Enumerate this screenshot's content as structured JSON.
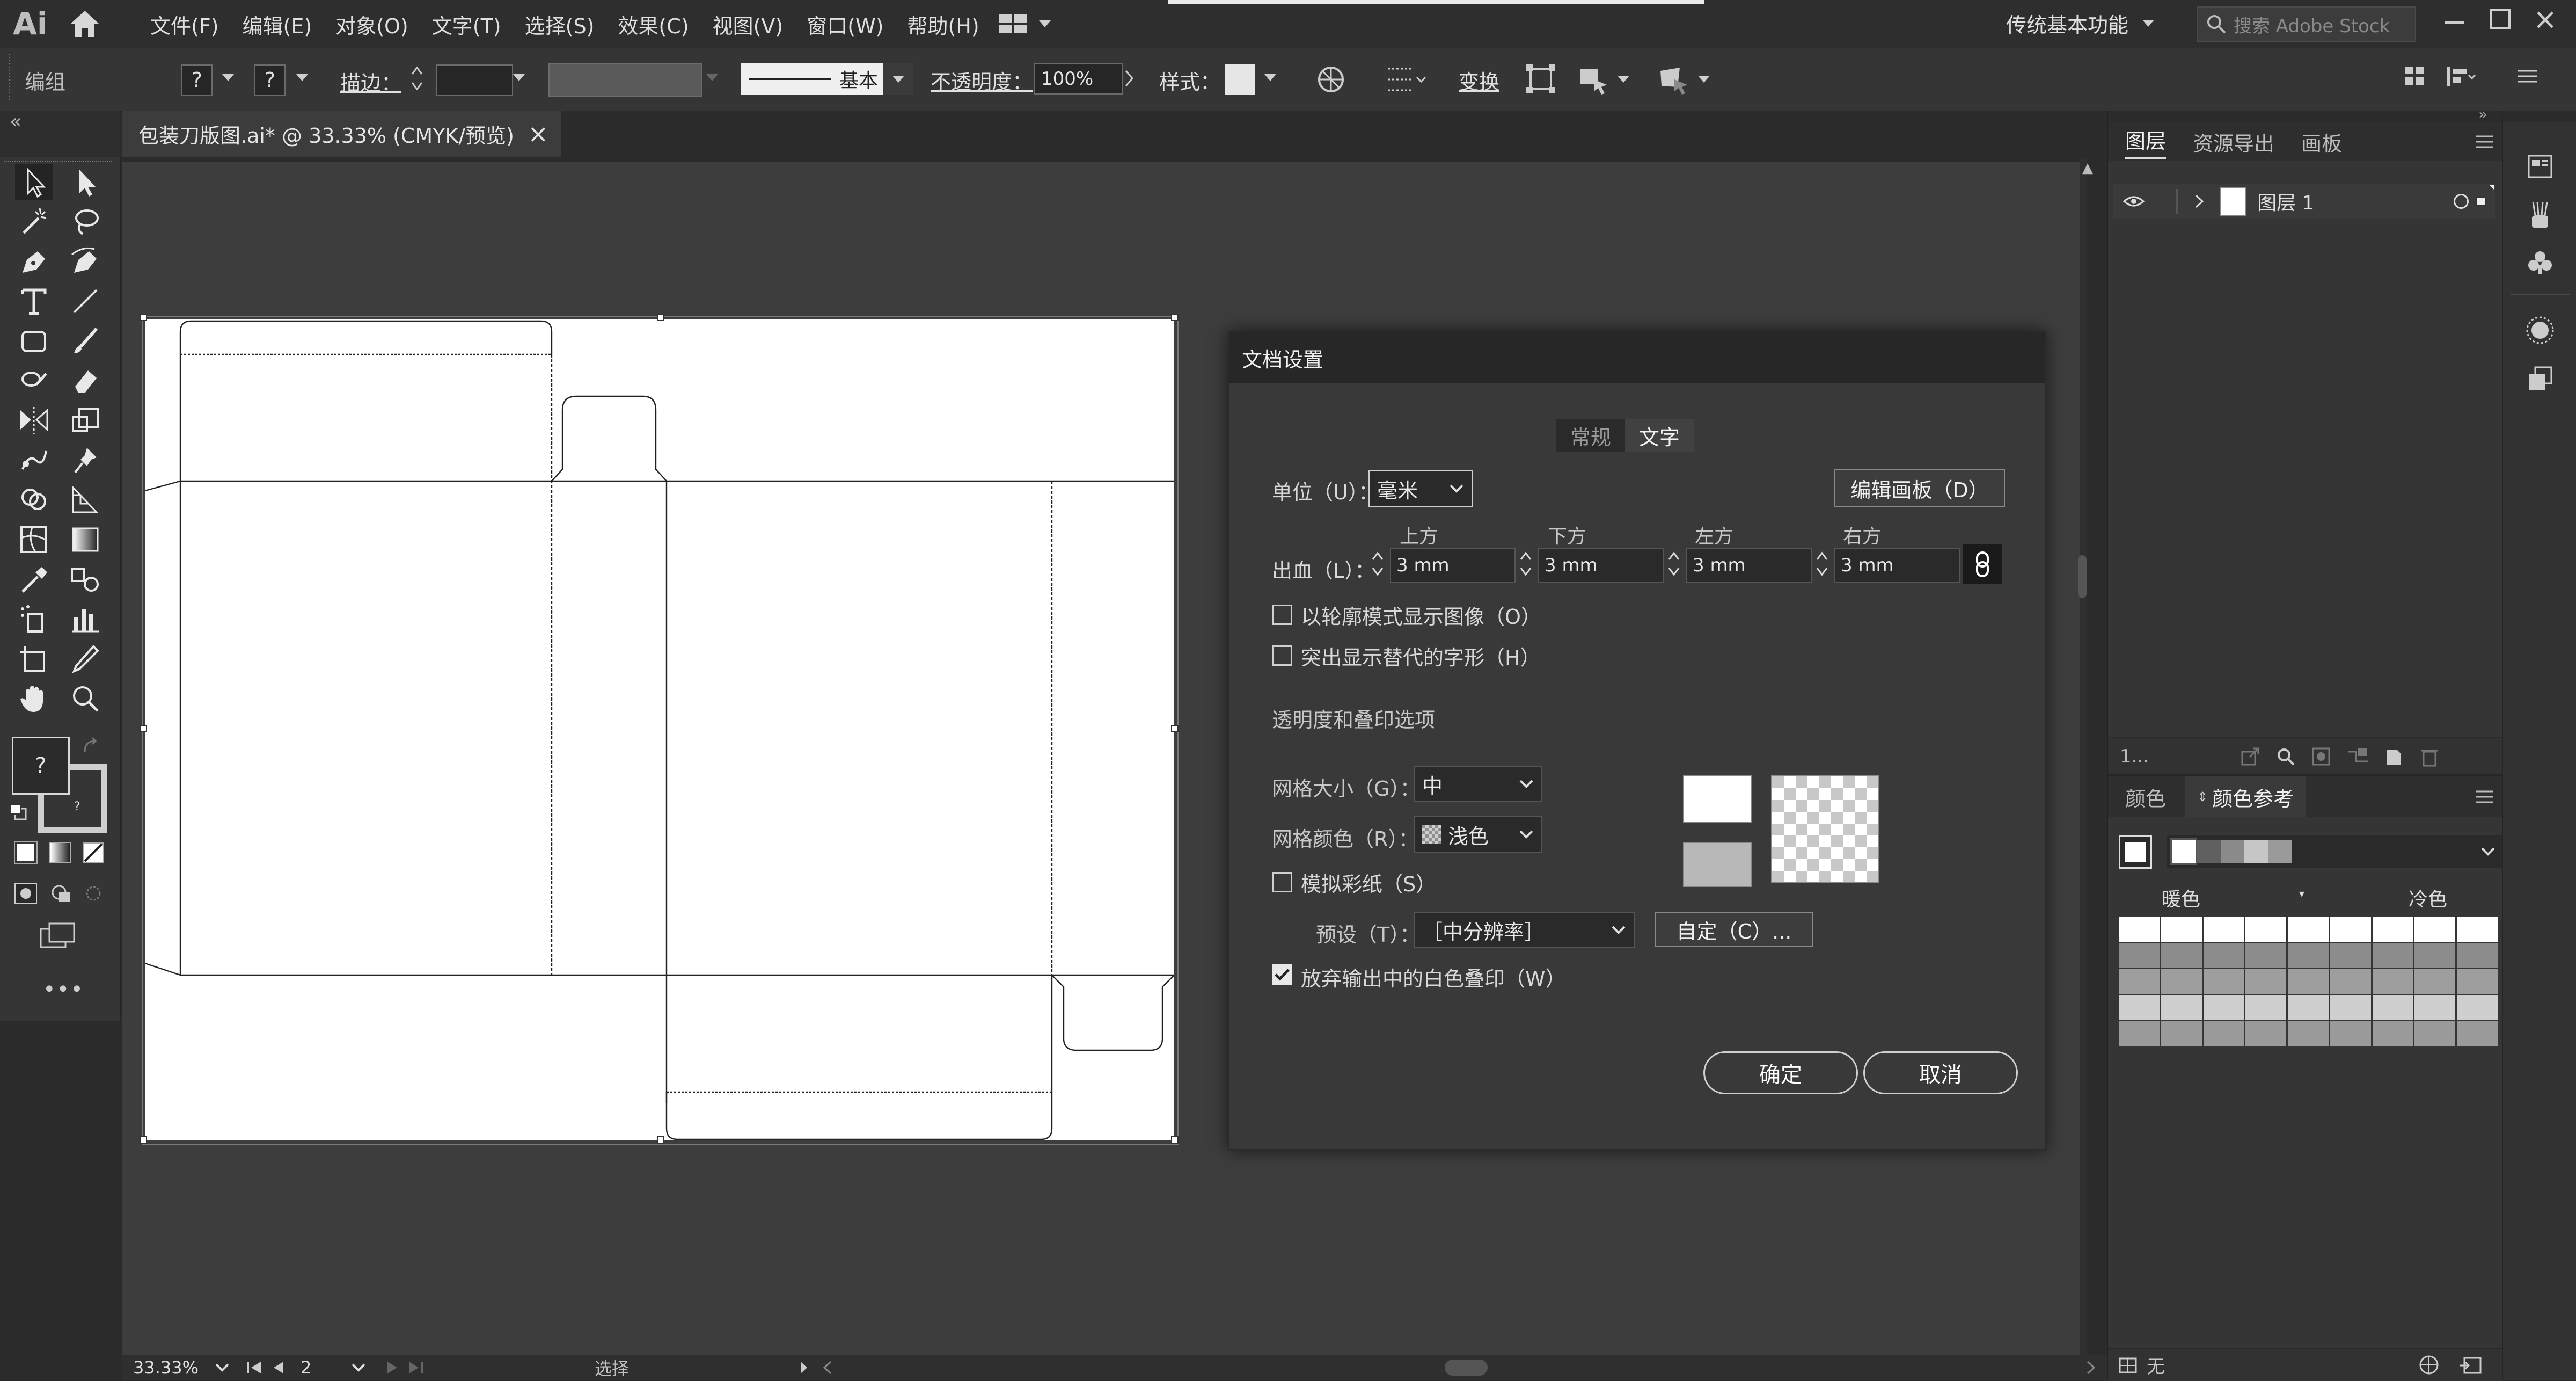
{
  "app": {
    "logo": "Ai",
    "workspace": "传统基本功能",
    "search_placeholder": "搜索 Adobe Stock"
  },
  "menu": [
    "文件(F)",
    "编辑(E)",
    "对象(O)",
    "文字(T)",
    "选择(S)",
    "效果(C)",
    "视图(V)",
    "窗口(W)",
    "帮助(H)"
  ],
  "controlbar": {
    "selection": "编组",
    "fill_symbol": "?",
    "stroke_symbol": "?",
    "stroke_label": "描边：",
    "brush_label": "基本",
    "opacity_label": "不透明度：",
    "opacity_value": "100%",
    "style_label": "样式：",
    "transform_label": "变换"
  },
  "document_tab": {
    "title": "包装刀版图.ai* @ 33.33% (CMYK/预览)",
    "close": "×"
  },
  "toolbar": {
    "fill_stroke_symbol": "?",
    "more": "•••"
  },
  "dialog": {
    "title": "文档设置",
    "tabs": [
      "常规",
      "文字"
    ],
    "active_tab": "文字",
    "units_label": "单位（U）：",
    "units_value": "毫米",
    "edit_artboard": "编辑画板（D）",
    "bleed_label": "出血（L）：",
    "bleed_headers": [
      "上方",
      "下方",
      "左方",
      "右方"
    ],
    "bleed_values": [
      "3 mm",
      "3 mm",
      "3 mm",
      "3 mm"
    ],
    "show_images_outline": "以轮廓模式显示图像（O）",
    "highlight_glyphs": "突出显示替代的字形（H）",
    "transparency_section": "透明度和叠印选项",
    "grid_size_label": "网格大小（G）：",
    "grid_size_value": "中",
    "grid_color_label": "网格颜色（R）：",
    "grid_color_value": "浅色",
    "simulate_paper": "模拟彩纸（S）",
    "preset_label": "预设（T）：",
    "preset_value": "［中分辨率］",
    "custom_button": "自定（C）...",
    "discard_white_overprint": "放弃输出中的白色叠印（W）",
    "discard_checked": true,
    "ok": "确定",
    "cancel": "取消"
  },
  "layers_panel": {
    "tabs": [
      "图层",
      "资源导出",
      "画板"
    ],
    "layer_name": "图层 1",
    "layer_count": "1..."
  },
  "color_panel": {
    "tabs": [
      "颜色",
      "颜色参考"
    ],
    "warm": "暖色",
    "cool": "冷色",
    "none_label": "无"
  },
  "statusbar": {
    "zoom": "33.33%",
    "artboard_number": "2",
    "tool": "选择"
  },
  "colors": {
    "ui_bg": "#2b2b2b",
    "panel_bg": "#353535",
    "dialog_bg": "#393939",
    "accent_white": "#ffffff"
  }
}
